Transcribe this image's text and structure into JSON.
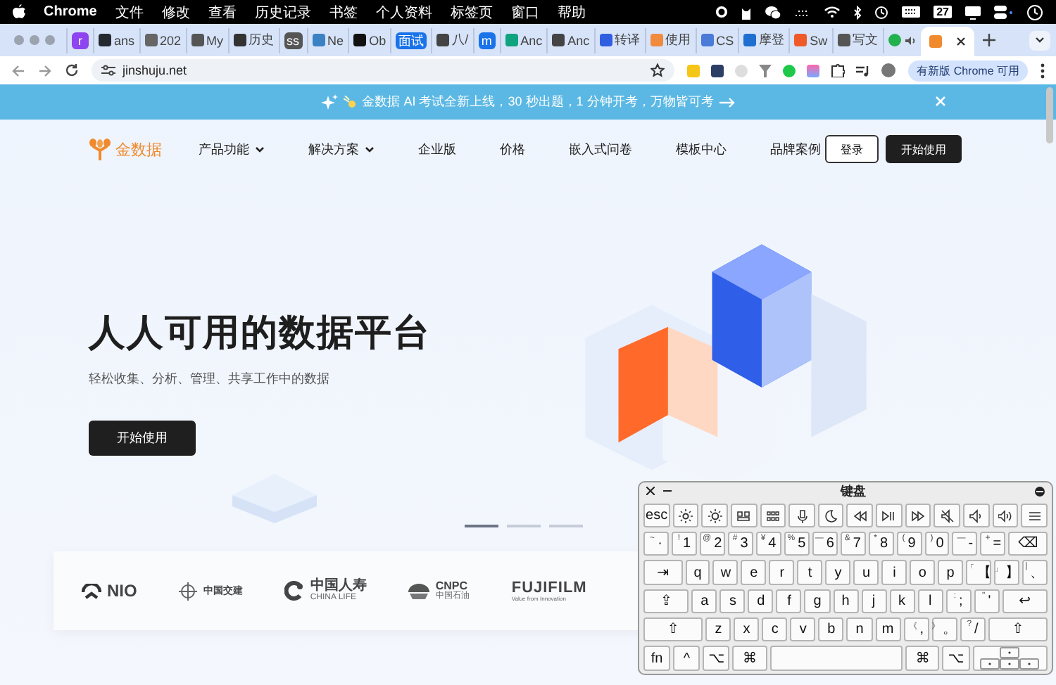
{
  "menu_bar": {
    "app": "Chrome",
    "items": [
      "文件",
      "修改",
      "查看",
      "历史记录",
      "书签",
      "个人资料",
      "标签页",
      "窗口",
      "帮助"
    ],
    "calendar_day": "27"
  },
  "tabs": [
    {
      "kind": "badge",
      "label": "r",
      "color": "#8e44ef",
      "selected": false
    },
    {
      "kind": "favicon",
      "label": "ans",
      "color": "#24292f",
      "selected": false
    },
    {
      "kind": "favicon",
      "label": "202",
      "color": "#666666",
      "selected": false
    },
    {
      "kind": "favicon",
      "label": "My",
      "color": "#555555",
      "selected": false
    },
    {
      "kind": "favicon",
      "label": "历史",
      "color": "#333333",
      "selected": false
    },
    {
      "kind": "badge",
      "label": "ss",
      "color": "#555555",
      "selected": false
    },
    {
      "kind": "favicon",
      "label": "Ne",
      "color": "#3b82c4",
      "selected": false
    },
    {
      "kind": "favicon",
      "label": "Ob",
      "color": "#111111",
      "selected": false
    },
    {
      "kind": "badge",
      "label": "面试",
      "color": "#1a73e8",
      "selected": false
    },
    {
      "kind": "favicon",
      "label": "八/",
      "color": "#444444",
      "selected": false
    },
    {
      "kind": "badge",
      "label": "m",
      "color": "#1a73e8",
      "selected": false
    },
    {
      "kind": "favicon",
      "label": "Anc",
      "color": "#10a37f",
      "selected": false
    },
    {
      "kind": "favicon",
      "label": "Anc",
      "color": "#444444",
      "selected": false
    },
    {
      "kind": "favicon",
      "label": "转译",
      "color": "#2f5fe0",
      "selected": false
    },
    {
      "kind": "favicon",
      "label": "使用",
      "color": "#f08a3c",
      "selected": false
    },
    {
      "kind": "favicon",
      "label": "CS",
      "color": "#4a7bd8",
      "selected": false
    },
    {
      "kind": "favicon",
      "label": "摩登",
      "color": "#1e6fd0",
      "selected": false
    },
    {
      "kind": "favicon",
      "label": "Sw",
      "color": "#f05a28",
      "selected": false
    },
    {
      "kind": "favicon",
      "label": "写文",
      "color": "#555555",
      "selected": false
    },
    {
      "kind": "audio",
      "color": "#22b14c",
      "selected": false
    },
    {
      "kind": "favicon",
      "color": "#f08a2c",
      "selected": true
    }
  ],
  "address_bar": {
    "url": "jinshuju.net",
    "update_button": "有新版 Chrome 可用"
  },
  "banner": {
    "text": "金数据 AI 考试全新上线，30 秒出题，1 分钟开考，万物皆可考"
  },
  "nav": {
    "logo": "金数据",
    "items": [
      {
        "label": "产品功能",
        "dropdown": true
      },
      {
        "label": "解决方案",
        "dropdown": true
      },
      {
        "label": "企业版",
        "dropdown": false
      },
      {
        "label": "价格",
        "dropdown": false
      },
      {
        "label": "嵌入式问卷",
        "dropdown": false
      },
      {
        "label": "模板中心",
        "dropdown": false
      },
      {
        "label": "品牌案例",
        "dropdown": false
      }
    ],
    "login": "登录",
    "start": "开始使用"
  },
  "hero": {
    "title": "人人可用的数据平台",
    "subtitle": "轻松收集、分析、管理、共享工作中的数据",
    "button": "开始使用",
    "slides": [
      {
        "selected": true
      },
      {
        "selected": false
      },
      {
        "selected": false
      }
    ]
  },
  "logos": [
    {
      "kind": "nio",
      "name": "NIO"
    },
    {
      "kind": "cccc",
      "name": "中国交建"
    },
    {
      "kind": "chinalife",
      "name": "中国人寿",
      "sub": "CHINA LIFE"
    },
    {
      "kind": "cnpc",
      "name": "CNPC",
      "sub": "中国石油"
    },
    {
      "kind": "fuji",
      "name": "FUJIFILM",
      "sub": "Value from Innovation"
    }
  ],
  "keyboard": {
    "title": "键盘",
    "rows": [
      {
        "keys": [
          {
            "main": "esc"
          },
          {
            "kind": "icon"
          },
          {
            "kind": "icon"
          },
          {
            "kind": "icon"
          },
          {
            "kind": "icon"
          },
          {
            "kind": "icon"
          },
          {
            "kind": "icon"
          },
          {
            "kind": "icon"
          },
          {
            "kind": "icon"
          },
          {
            "kind": "icon"
          },
          {
            "kind": "icon"
          },
          {
            "kind": "icon"
          },
          {
            "kind": "icon"
          },
          {
            "kind": "icon"
          }
        ]
      },
      {
        "keys": [
          {
            "main": "·",
            "shift": "~"
          },
          {
            "main": "1",
            "shift": "!"
          },
          {
            "main": "2",
            "shift": "@"
          },
          {
            "main": "3",
            "shift": "#"
          },
          {
            "main": "4",
            "shift": "¥"
          },
          {
            "main": "5",
            "shift": "%"
          },
          {
            "main": "6",
            "shift": "—"
          },
          {
            "main": "7",
            "shift": "&"
          },
          {
            "main": "8",
            "shift": "*"
          },
          {
            "main": "9",
            "shift": "("
          },
          {
            "main": "0",
            "shift": ")"
          },
          {
            "main": "-",
            "shift": "—"
          },
          {
            "main": "=",
            "shift": "+"
          },
          {
            "main": "⌫",
            "kind": "backspace"
          }
        ]
      },
      {
        "keys": [
          {
            "main": "⇥",
            "kind": "tab"
          },
          {
            "main": "q"
          },
          {
            "main": "w"
          },
          {
            "main": "e"
          },
          {
            "main": "r"
          },
          {
            "main": "t"
          },
          {
            "main": "y"
          },
          {
            "main": "u"
          },
          {
            "main": "i"
          },
          {
            "main": "o"
          },
          {
            "main": "p"
          },
          {
            "main": "【",
            "shift": "「"
          },
          {
            "main": "】",
            "shift": "」"
          },
          {
            "main": "、",
            "shift": "|"
          }
        ]
      },
      {
        "keys": [
          {
            "main": "⇪",
            "kind": "caps"
          },
          {
            "main": "a"
          },
          {
            "main": "s"
          },
          {
            "main": "d"
          },
          {
            "main": "f"
          },
          {
            "main": "g"
          },
          {
            "main": "h"
          },
          {
            "main": "j"
          },
          {
            "main": "k"
          },
          {
            "main": "l"
          },
          {
            "main": ";",
            "shift": ":"
          },
          {
            "main": "'",
            "shift": "\""
          },
          {
            "main": "↩",
            "kind": "return"
          }
        ]
      },
      {
        "keys": [
          {
            "main": "⇧",
            "kind": "shift"
          },
          {
            "main": "z"
          },
          {
            "main": "x"
          },
          {
            "main": "c"
          },
          {
            "main": "v"
          },
          {
            "main": "b"
          },
          {
            "main": "n"
          },
          {
            "main": "m"
          },
          {
            "main": ",",
            "shift": "《"
          },
          {
            "main": "。",
            "shift": "》"
          },
          {
            "main": "/",
            "shift": "?"
          },
          {
            "main": "⇧",
            "kind": "shift"
          }
        ]
      },
      {
        "keys": [
          {
            "main": "fn"
          },
          {
            "main": "^"
          },
          {
            "main": "⌥"
          },
          {
            "main": "⌘",
            "kind": "cmd"
          },
          {
            "kind": "space"
          },
          {
            "main": "⌘",
            "kind": "cmd"
          },
          {
            "main": "⌥"
          },
          {
            "kind": "arrows"
          }
        ]
      }
    ]
  }
}
